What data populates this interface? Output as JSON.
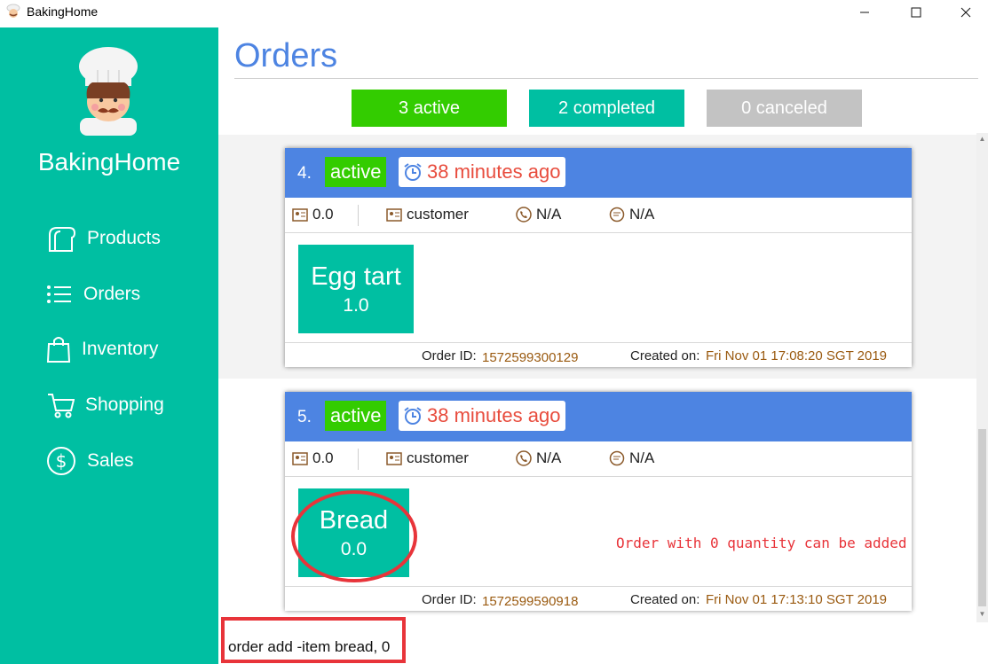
{
  "window": {
    "title": "BakingHome"
  },
  "sidebar": {
    "brand": "BakingHome",
    "items": [
      {
        "label": "Products",
        "icon": "bread-icon"
      },
      {
        "label": "Orders",
        "icon": "list-icon"
      },
      {
        "label": "Inventory",
        "icon": "bag-icon"
      },
      {
        "label": "Shopping",
        "icon": "cart-icon"
      },
      {
        "label": "Sales",
        "icon": "dollar-icon"
      }
    ]
  },
  "main": {
    "title": "Orders",
    "filters": {
      "active": "3 active",
      "completed": "2 completed",
      "canceled": "0 canceled"
    }
  },
  "orders": [
    {
      "number": "4.",
      "status": "active",
      "time": "38 minutes ago",
      "total": "0.0",
      "customer": "customer",
      "phone": "N/A",
      "remark": "N/A",
      "item": {
        "name": "Egg tart",
        "quantity": "1.0"
      },
      "order_id_label": "Order ID:",
      "order_id": "1572599300129",
      "created_label": "Created on:",
      "created_on": "Fri Nov 01 17:08:20 SGT 2019"
    },
    {
      "number": "5.",
      "status": "active",
      "time": "38 minutes ago",
      "total": "0.0",
      "customer": "customer",
      "phone": "N/A",
      "remark": "N/A",
      "item": {
        "name": "Bread",
        "quantity": "0.0"
      },
      "order_id_label": "Order ID:",
      "order_id": "1572599590918",
      "created_label": "Created on:",
      "created_on": "Fri Nov 01 17:13:10 SGT 2019"
    }
  ],
  "annotation": "Order with 0 quantity can be added",
  "command": {
    "value": "order add -item bread, 0"
  },
  "colors": {
    "teal": "#00bfa2",
    "blue": "#4d84e2",
    "green": "#33cc00",
    "gray": "#c3c3c3",
    "red": "#e8343a"
  }
}
